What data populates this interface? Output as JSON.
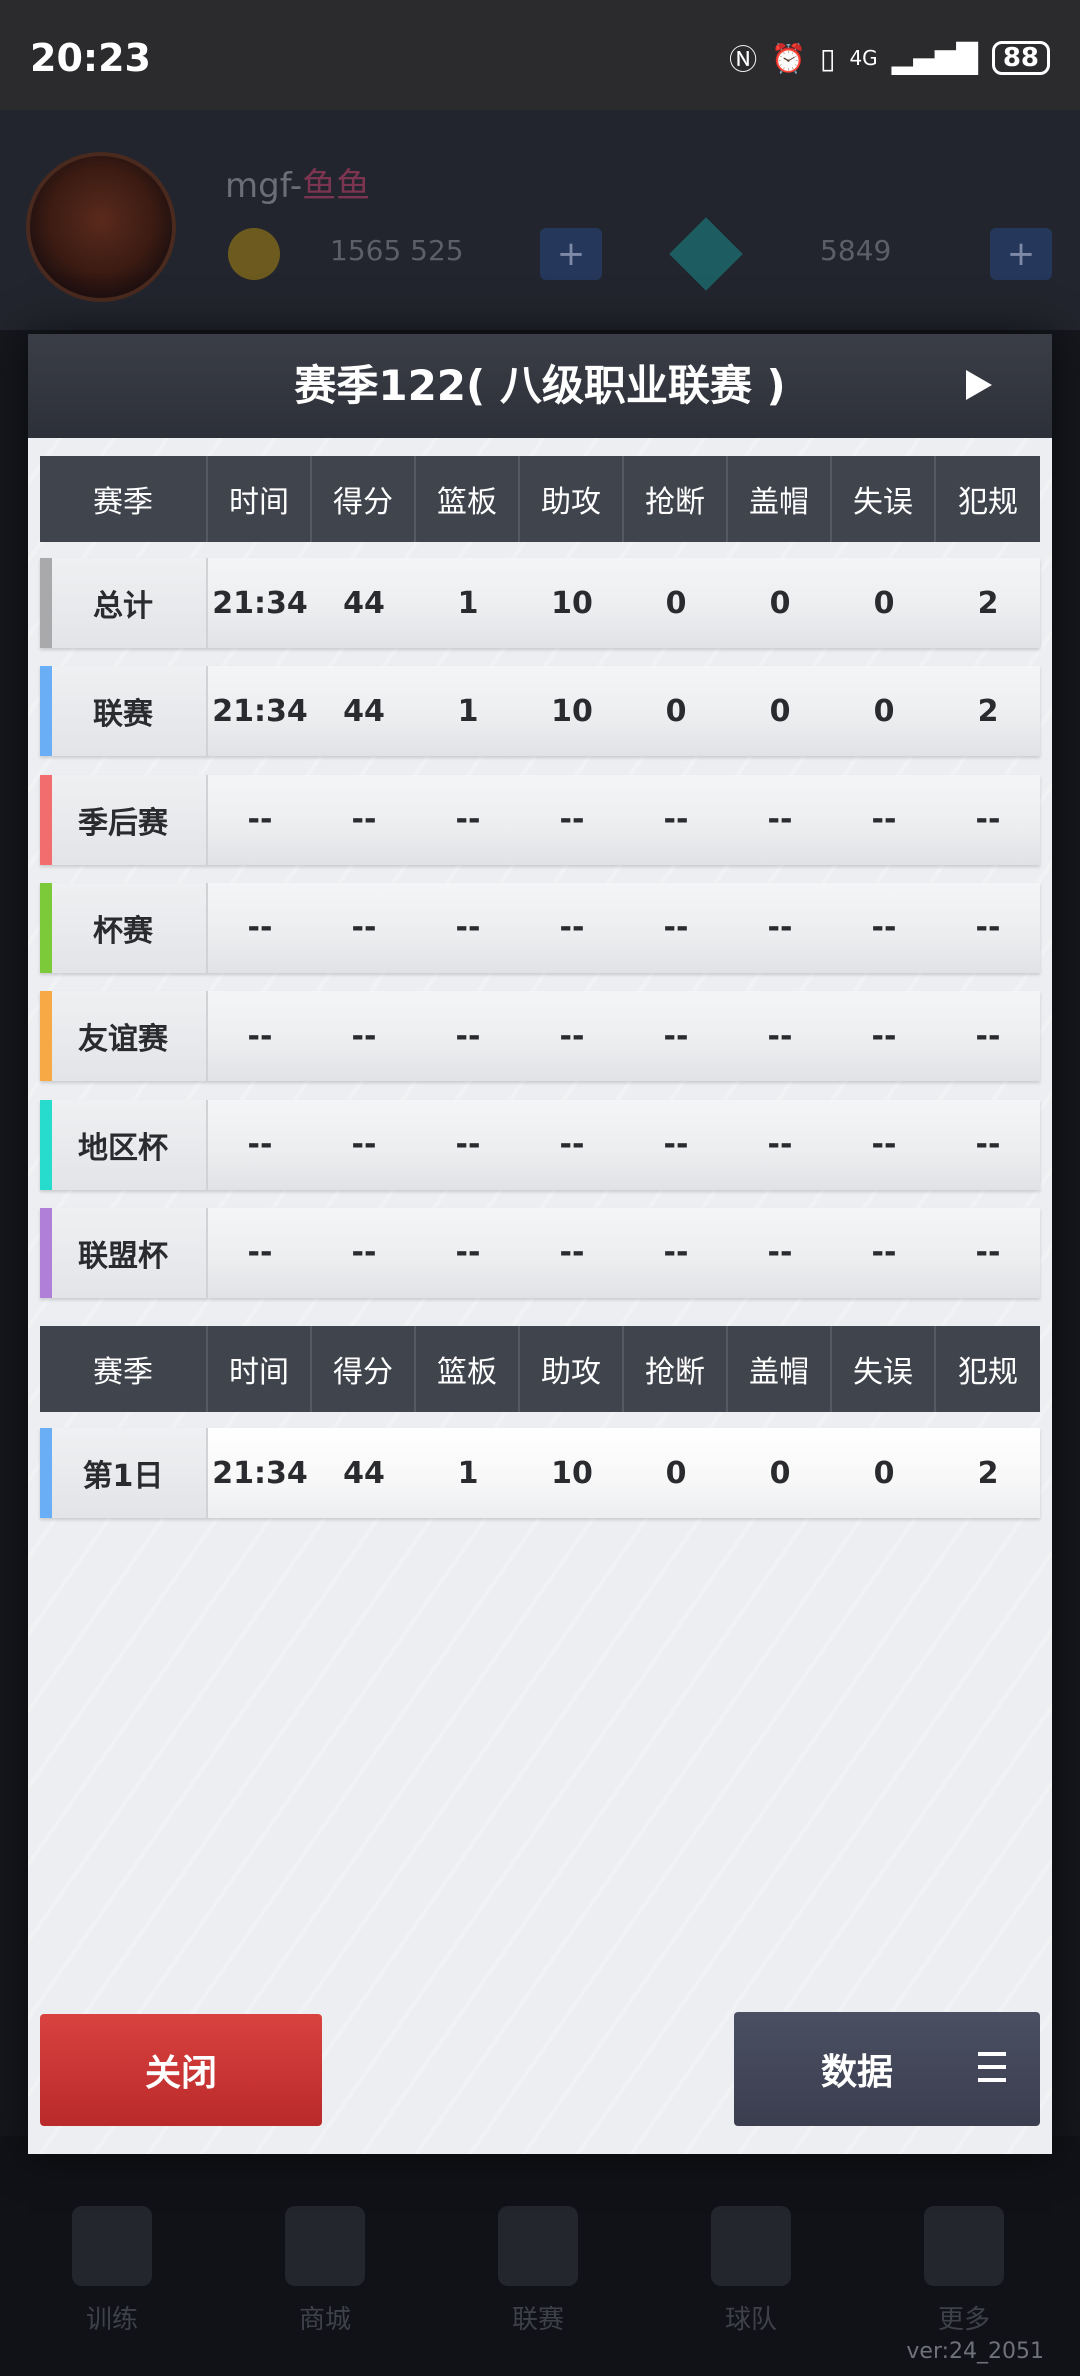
{
  "status_bar": {
    "time": "20:23",
    "network": "4G",
    "battery": "88"
  },
  "background": {
    "name": "mgf-",
    "name_tag": "鱼鱼",
    "coins": "1565 525",
    "gems": "5849",
    "tabs": [
      "训练",
      "商城",
      "联赛",
      "球队",
      "更多"
    ],
    "version": "ver:24_2051"
  },
  "dialog": {
    "title": "赛季122( 八级职业联赛 )",
    "headers": [
      "赛季",
      "时间",
      "得分",
      "篮板",
      "助攻",
      "抢断",
      "盖帽",
      "失误",
      "犯规"
    ],
    "rows": [
      {
        "label": "总计",
        "accent": "#a9a9ab",
        "values": [
          "21:34",
          "44",
          "1",
          "10",
          "0",
          "0",
          "0",
          "2"
        ]
      },
      {
        "label": "联赛",
        "accent": "#6aaef5",
        "values": [
          "21:34",
          "44",
          "1",
          "10",
          "0",
          "0",
          "0",
          "2"
        ]
      },
      {
        "label": "季后赛",
        "accent": "#f26d6d",
        "values": [
          "--",
          "--",
          "--",
          "--",
          "--",
          "--",
          "--",
          "--"
        ]
      },
      {
        "label": "杯赛",
        "accent": "#7cc93a",
        "values": [
          "--",
          "--",
          "--",
          "--",
          "--",
          "--",
          "--",
          "--"
        ]
      },
      {
        "label": "友谊赛",
        "accent": "#f6a944",
        "values": [
          "--",
          "--",
          "--",
          "--",
          "--",
          "--",
          "--",
          "--"
        ]
      },
      {
        "label": "地区杯",
        "accent": "#27dccd",
        "values": [
          "--",
          "--",
          "--",
          "--",
          "--",
          "--",
          "--",
          "--"
        ]
      },
      {
        "label": "联盟杯",
        "accent": "#b07fd8",
        "values": [
          "--",
          "--",
          "--",
          "--",
          "--",
          "--",
          "--",
          "--"
        ]
      }
    ],
    "headers2": [
      "赛季",
      "时间",
      "得分",
      "篮板",
      "助攻",
      "抢断",
      "盖帽",
      "失误",
      "犯规"
    ],
    "day_rows": [
      {
        "label": "第1日",
        "accent": "#6aaef5",
        "values": [
          "21:34",
          "44",
          "1",
          "10",
          "0",
          "0",
          "0",
          "2"
        ]
      }
    ],
    "close_label": "关闭",
    "data_label": "数据"
  }
}
